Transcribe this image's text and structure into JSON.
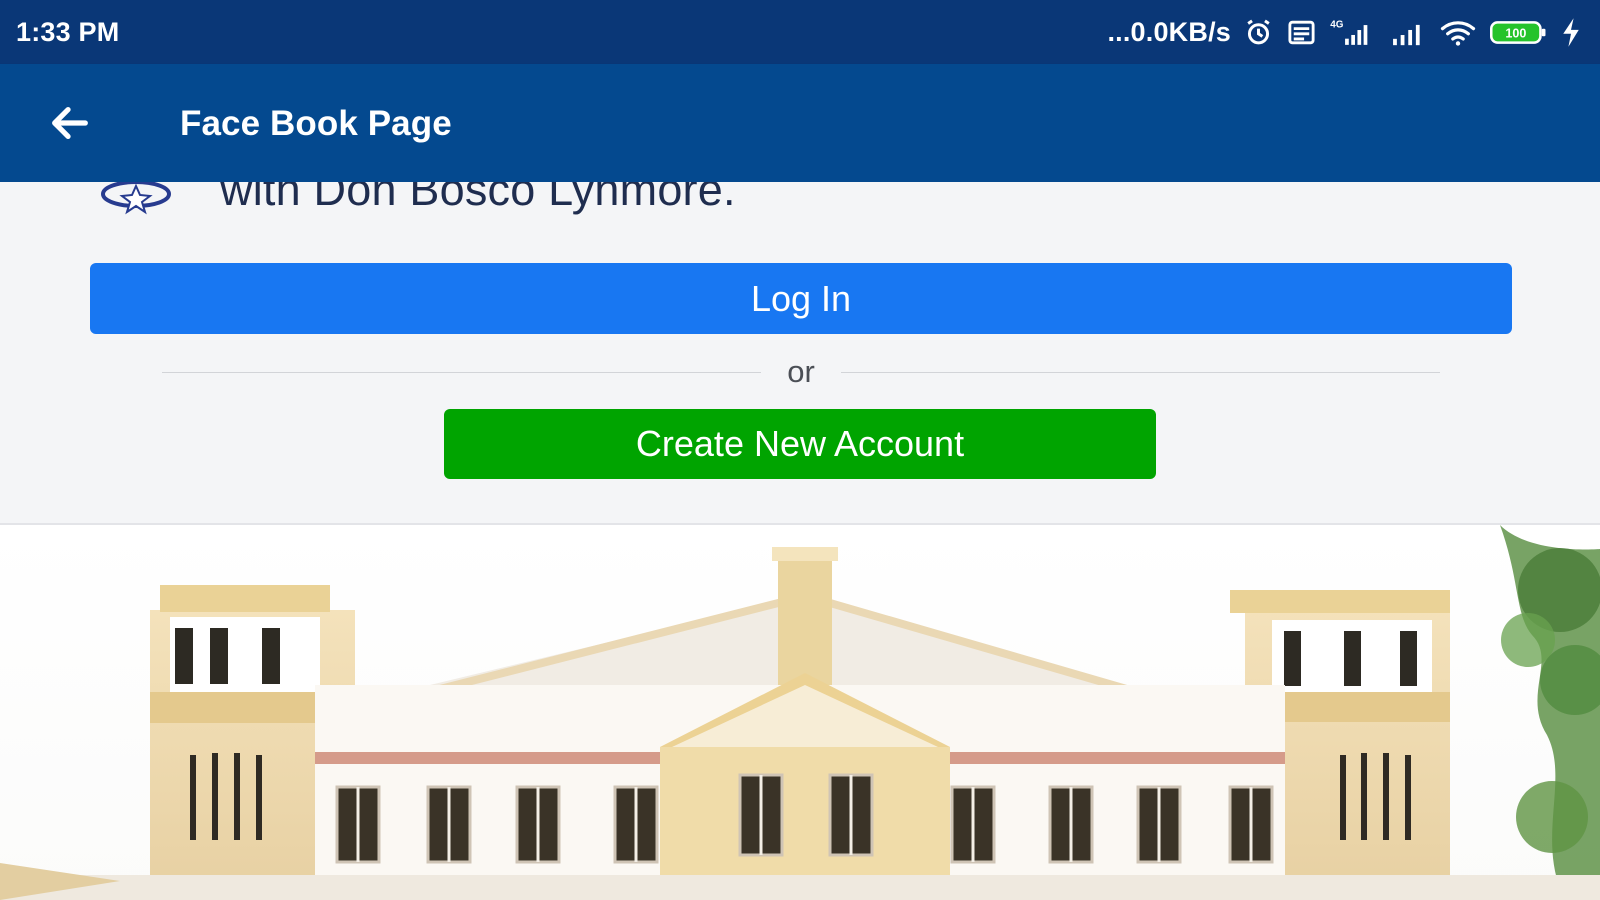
{
  "status_bar": {
    "time": "1:33 PM",
    "network_speed": "...0.0KB/s",
    "icons": [
      "alarm-clock-icon",
      "message-icon",
      "signal-4g-icon",
      "signal-icon",
      "wifi-icon",
      "battery-icon",
      "charging-bolt-icon"
    ],
    "battery_level": "100"
  },
  "app_bar": {
    "back_icon": "arrow-left-icon",
    "title": "Face Book Page"
  },
  "login_panel": {
    "partial_header_text": "with Don Bosco Lynmore.",
    "login_button_label": "Log In",
    "divider_text": "or",
    "create_account_label": "Create New Account"
  },
  "cover_image": {
    "icon": "building-image"
  },
  "colors": {
    "status_bar_bg": "#0a3777",
    "app_bar_bg": "#04498f",
    "login_blue": "#1877f2",
    "create_green": "#00a400",
    "panel_bg": "#f4f5f7"
  }
}
